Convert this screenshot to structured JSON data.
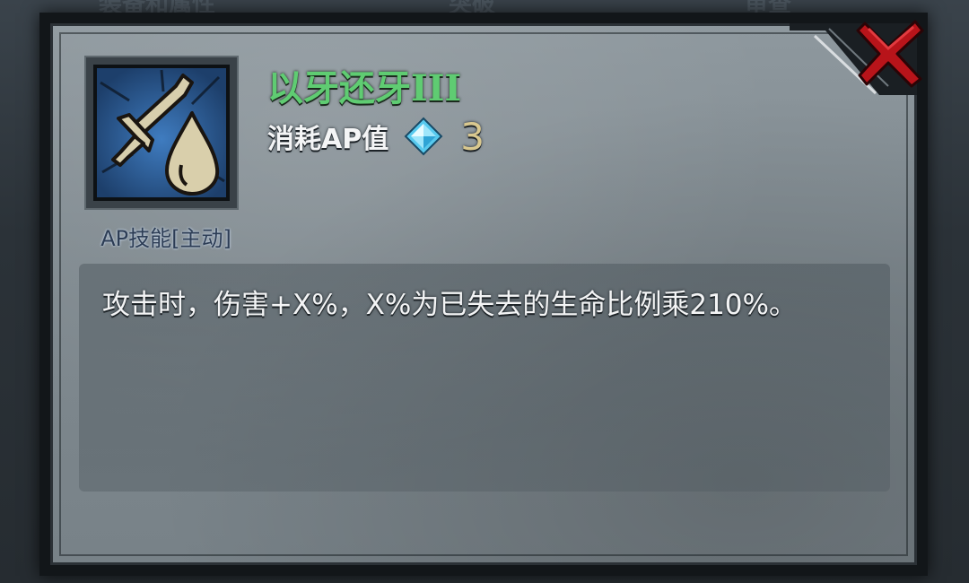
{
  "background": {
    "tabs": [
      "装备和属性",
      "突破",
      "审查"
    ]
  },
  "dialog": {
    "close_icon": "close-x-icon",
    "skill": {
      "icon": "sword-and-drop-icon",
      "type_label": "AP技能[主动]",
      "name": "以牙还牙III",
      "cost_label": "消耗AP值",
      "cost_icon": "ap-crystal-icon",
      "cost_value": "3"
    },
    "description": "攻击时，伤害+X%，X%为已失去的生命比例乘210%。"
  },
  "colors": {
    "skill_name": "#5fcc72",
    "cost_value": "#d9c88f",
    "close_red": "#c4141a",
    "icon_background": "#2f5f9a"
  }
}
